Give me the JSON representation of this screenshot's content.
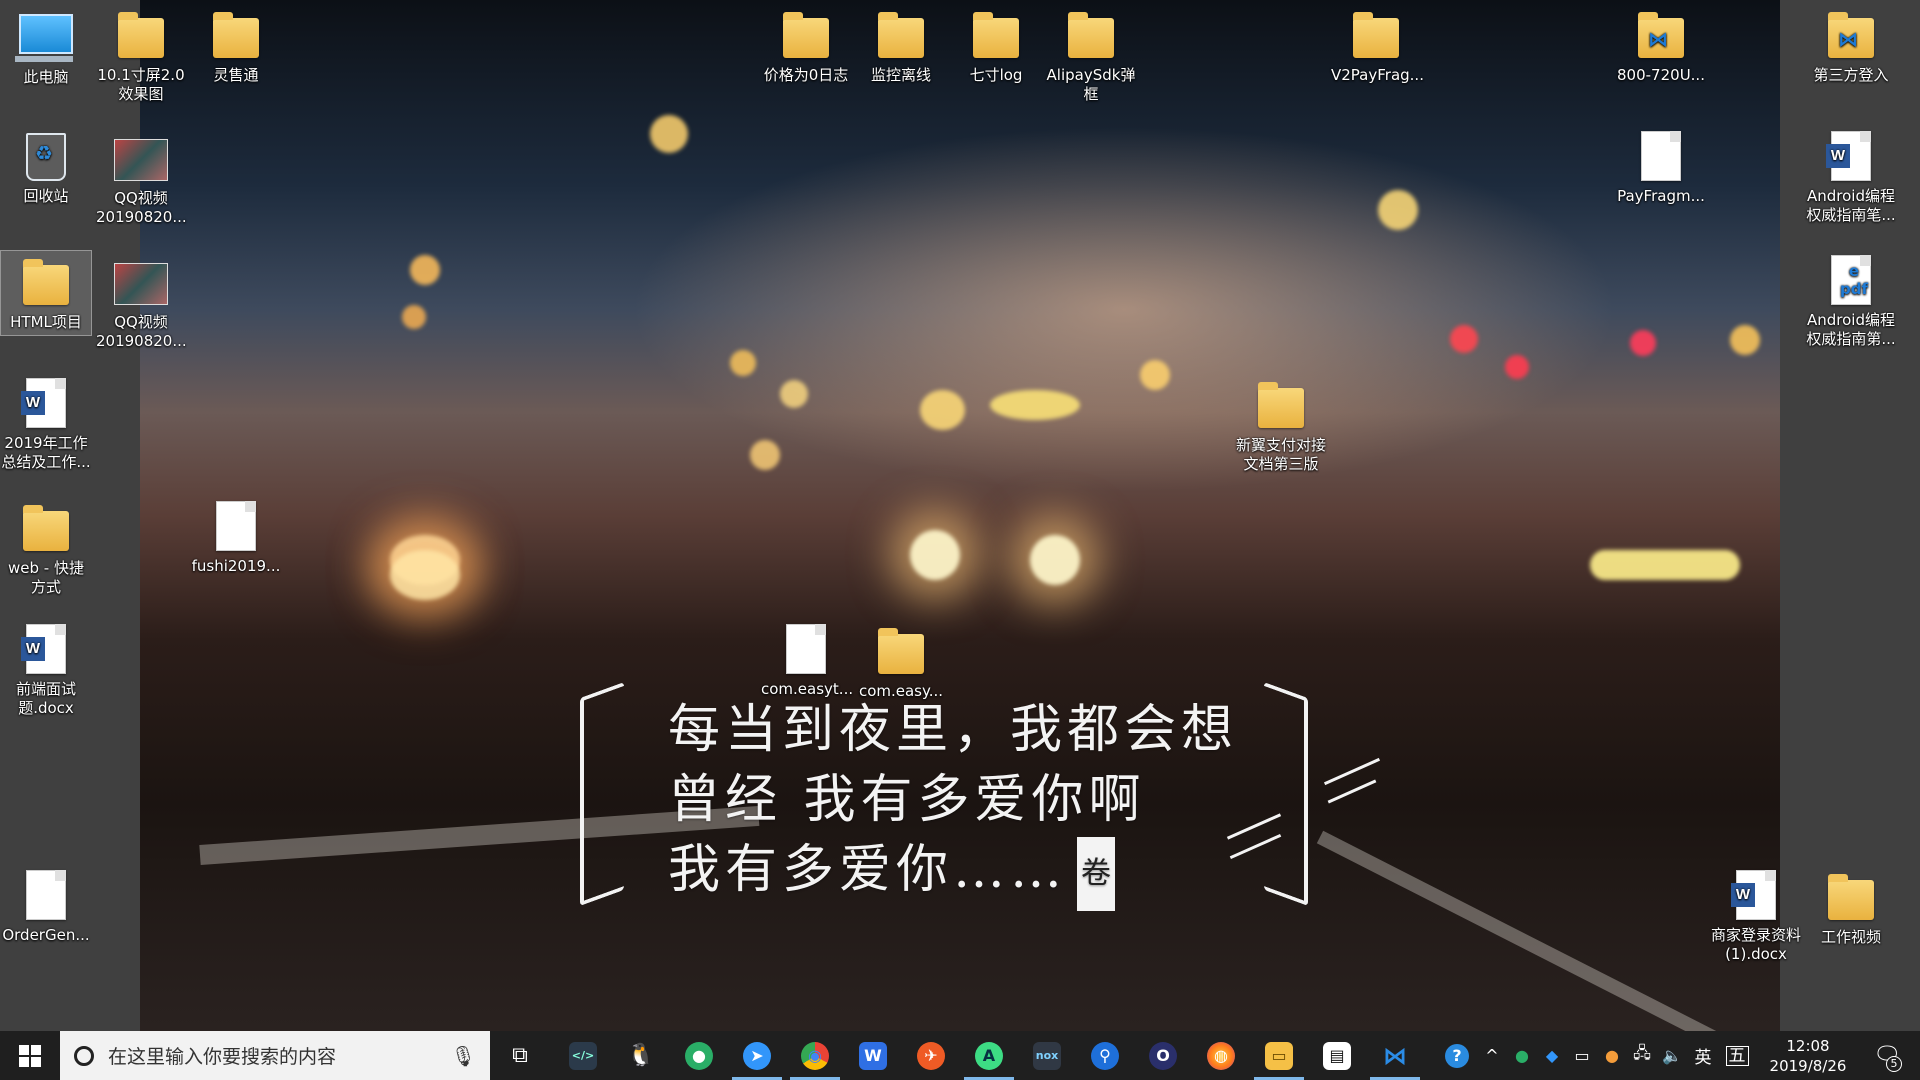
{
  "desktop": {
    "icons": [
      {
        "id": "this-pc",
        "label": "此电脑",
        "type": "pc"
      },
      {
        "id": "screen-effects",
        "label": "10.1寸屏2.0效果图",
        "type": "folder-doc"
      },
      {
        "id": "lingshoutong",
        "label": "灵售通",
        "type": "folder"
      },
      {
        "id": "recycle-bin",
        "label": "回收站",
        "type": "bin"
      },
      {
        "id": "qq-video-1",
        "label": "QQ视频20190820...",
        "type": "thumb"
      },
      {
        "id": "html-project",
        "label": "HTML项目",
        "type": "folder"
      },
      {
        "id": "qq-video-2",
        "label": "QQ视频20190820...",
        "type": "thumb"
      },
      {
        "id": "work-summary",
        "label": "2019年工作总结及工作...",
        "type": "word"
      },
      {
        "id": "web-shortcut",
        "label": "web - 快捷方式",
        "type": "folder"
      },
      {
        "id": "fushi",
        "label": "fushi2019...",
        "type": "file"
      },
      {
        "id": "frontend-interview",
        "label": "前端面试题.docx",
        "type": "word"
      },
      {
        "id": "ordergen",
        "label": "OrderGen...",
        "type": "file"
      },
      {
        "id": "price-zero-log",
        "label": "价格为0日志",
        "type": "folder"
      },
      {
        "id": "monitor-offline",
        "label": "监控离线",
        "type": "folder"
      },
      {
        "id": "seven-inch-log",
        "label": "七寸log",
        "type": "folder"
      },
      {
        "id": "alipay-sdk",
        "label": "AlipaySdk弹框",
        "type": "folder"
      },
      {
        "id": "v2payfrag",
        "label": "V2PayFrag...",
        "type": "folder"
      },
      {
        "id": "800-720",
        "label": "800-720U...",
        "type": "vs"
      },
      {
        "id": "third-login",
        "label": "第三方登入",
        "type": "vs"
      },
      {
        "id": "payfragm",
        "label": "PayFragm...",
        "type": "file"
      },
      {
        "id": "android-notes",
        "label": "Android编程权威指南笔...",
        "type": "word"
      },
      {
        "id": "android-pdf",
        "label": "Android编程权威指南第...",
        "type": "pdf"
      },
      {
        "id": "xinyi-pay",
        "label": "新翼支付对接文档第三版",
        "type": "folder"
      },
      {
        "id": "com-easyt",
        "label": "com.easyt...",
        "type": "file"
      },
      {
        "id": "com-easy",
        "label": "com.easy...",
        "type": "folder"
      },
      {
        "id": "merchant-login",
        "label": "商家登录资料(1).docx",
        "type": "word"
      },
      {
        "id": "work-video",
        "label": "工作视频",
        "type": "folder"
      }
    ]
  },
  "wallpaper": {
    "quote_lines": [
      "每当到夜里，我都会想",
      "曾经 我有多爱你啊",
      "我有多爱你……"
    ],
    "seal": "卷"
  },
  "taskbar": {
    "search_placeholder": "在这里输入你要搜索的内容",
    "apps": [
      {
        "name": "terminal",
        "glyph": "</>",
        "color": "#2b3a4a"
      },
      {
        "name": "qq",
        "glyph": "🐧",
        "color": "#1f1f1f"
      },
      {
        "name": "wechat",
        "glyph": "●",
        "color": "#2aae67"
      },
      {
        "name": "dingtalk",
        "glyph": "➤",
        "color": "#3296fa"
      },
      {
        "name": "chrome",
        "glyph": "◉",
        "color": "#e94235"
      },
      {
        "name": "wps",
        "glyph": "W",
        "color": "#2f6fe4"
      },
      {
        "name": "postman",
        "glyph": "✈",
        "color": "#ef5b25"
      },
      {
        "name": "android-studio",
        "glyph": "A",
        "color": "#3ddc84"
      },
      {
        "name": "nox",
        "glyph": "nox",
        "color": "#303844"
      },
      {
        "name": "maps",
        "glyph": "⚲",
        "color": "#1e6fd9"
      },
      {
        "name": "eclipse",
        "glyph": "O",
        "color": "#2a2f6b"
      },
      {
        "name": "firefox",
        "glyph": "◍",
        "color": "#ff7b1c"
      },
      {
        "name": "file-explorer",
        "glyph": "▭",
        "color": "#f5c046"
      },
      {
        "name": "movie-maker",
        "glyph": "▤",
        "color": "#555"
      },
      {
        "name": "vscode",
        "glyph": "⋈",
        "color": "#2b8ce6"
      }
    ],
    "tray": {
      "ime": "英",
      "ime_mode": "五",
      "time": "12:08",
      "date": "2019/8/26",
      "notifications": "5"
    }
  }
}
